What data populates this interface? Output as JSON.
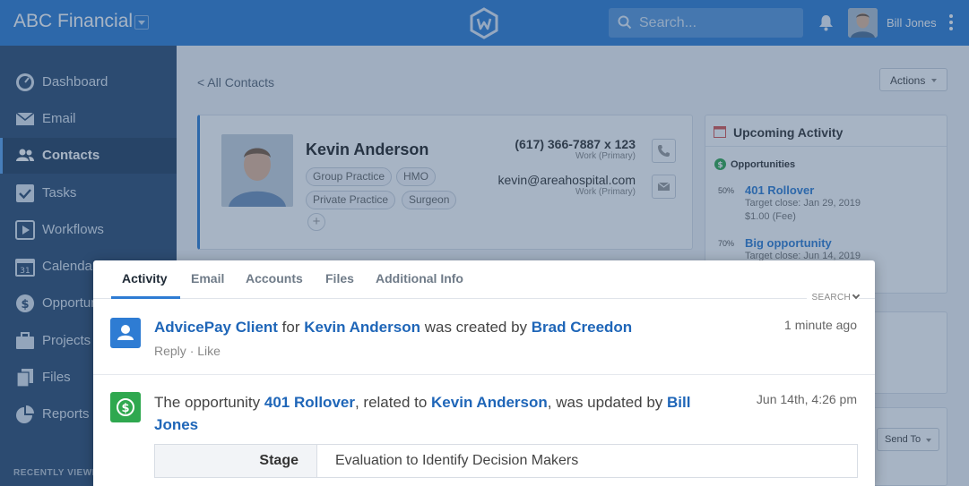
{
  "colors": {
    "primary": "#2e7cd3",
    "sidebar": "#2b4a70",
    "success": "#2fa84f",
    "link": "#1f66b8"
  },
  "header": {
    "brand": "ABC Financial",
    "search_placeholder": "Search...",
    "user_name": "Bill Jones"
  },
  "sidebar": {
    "items": [
      {
        "label": "Dashboard",
        "icon": "dashboard-icon"
      },
      {
        "label": "Email",
        "icon": "envelope-icon"
      },
      {
        "label": "Contacts",
        "icon": "contacts-icon",
        "active": true
      },
      {
        "label": "Tasks",
        "icon": "checkbox-icon"
      },
      {
        "label": "Workflows",
        "icon": "play-icon"
      },
      {
        "label": "Calendar",
        "icon": "calendar-icon"
      },
      {
        "label": "Opportunities",
        "icon": "dollar-icon"
      },
      {
        "label": "Projects",
        "icon": "briefcase-icon"
      },
      {
        "label": "Files",
        "icon": "files-icon"
      },
      {
        "label": "Reports",
        "icon": "pie-chart-icon"
      }
    ],
    "recent_label": "RECENTLY VIEWED"
  },
  "page": {
    "back_link": "< All Contacts",
    "actions_label": "Actions",
    "send_to_label": "Send To"
  },
  "contact": {
    "name": "Kevin Anderson",
    "tags": [
      "Group Practice",
      "HMO",
      "Private Practice",
      "Surgeon"
    ],
    "phone": "(617) 366-7887 x 123",
    "phone_type": "Work (Primary)",
    "email": "kevin@areahospital.com",
    "email_type": "Work (Primary)"
  },
  "upcoming": {
    "title": "Upcoming Activity",
    "section": "Opportunities",
    "items": [
      {
        "pct": "50%",
        "name": "401 Rollover",
        "close": "Target close: Jan 29, 2019",
        "fee": "$1.00 (Fee)"
      },
      {
        "pct": "70%",
        "name": "Big opportunity",
        "close": "Target close: Jun 14, 2019"
      }
    ]
  },
  "activity": {
    "tabs": [
      "Activity",
      "Email",
      "Accounts",
      "Files",
      "Additional Info"
    ],
    "search_label": "SEARCH",
    "items": [
      {
        "icon": "person-icon",
        "link1": "AdvicePay Client",
        "t1": " for ",
        "link2": "Kevin Anderson",
        "t2": " was created by ",
        "link3": "Brad Creedon",
        "time": "1 minute ago",
        "reply": "Reply",
        "sep": "·",
        "like": "Like"
      },
      {
        "icon": "dollar-icon",
        "t0": "The opportunity ",
        "link1": "401 Rollover",
        "t1": ", related to ",
        "link2": "Kevin Anderson",
        "t2": ", was updated by ",
        "link3": "Bill Jones",
        "time": "Jun 14th, 4:26 pm",
        "detail_key": "Stage",
        "detail_value": "Evaluation to Identify Decision Makers"
      }
    ]
  }
}
